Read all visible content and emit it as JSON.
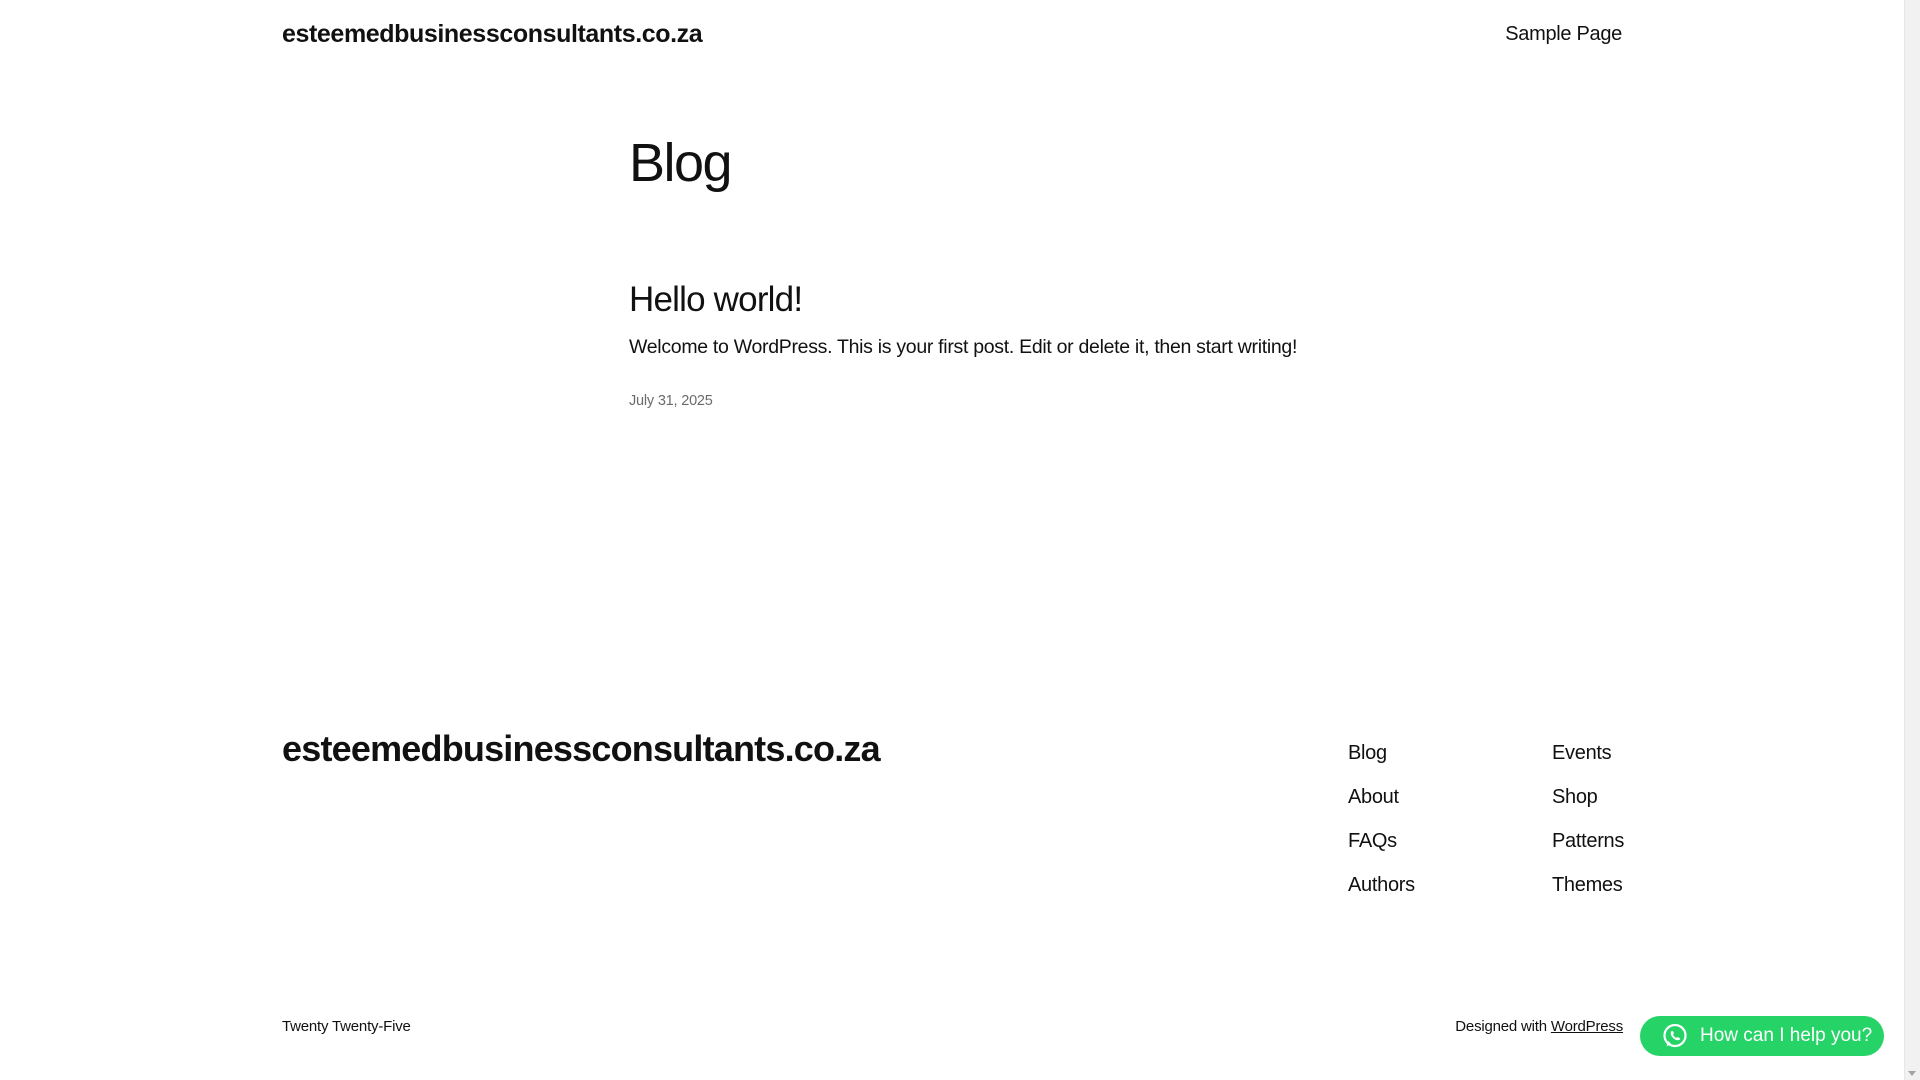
{
  "header": {
    "site_title": "esteemedbusinessconsultants.co.za",
    "nav": [
      "Sample Page"
    ]
  },
  "main": {
    "page_title": "Blog",
    "posts": [
      {
        "title": "Hello world!",
        "excerpt": "Welcome to WordPress. This is your first post. Edit or delete it, then start writing!",
        "date": "July 31, 2025"
      }
    ]
  },
  "footer": {
    "site_title": "esteemedbusinessconsultants.co.za",
    "nav_col_1": [
      "Blog",
      "About",
      "FAQs",
      "Authors"
    ],
    "nav_col_2": [
      "Events",
      "Shop",
      "Patterns",
      "Themes"
    ],
    "theme_credit": "Twenty Twenty-Five",
    "designed_with_text": "Designed with",
    "designed_with_link": "WordPress"
  },
  "chat_widget": {
    "label": "How can I help you?",
    "icon": "whatsapp-icon",
    "color": "#25d366"
  }
}
